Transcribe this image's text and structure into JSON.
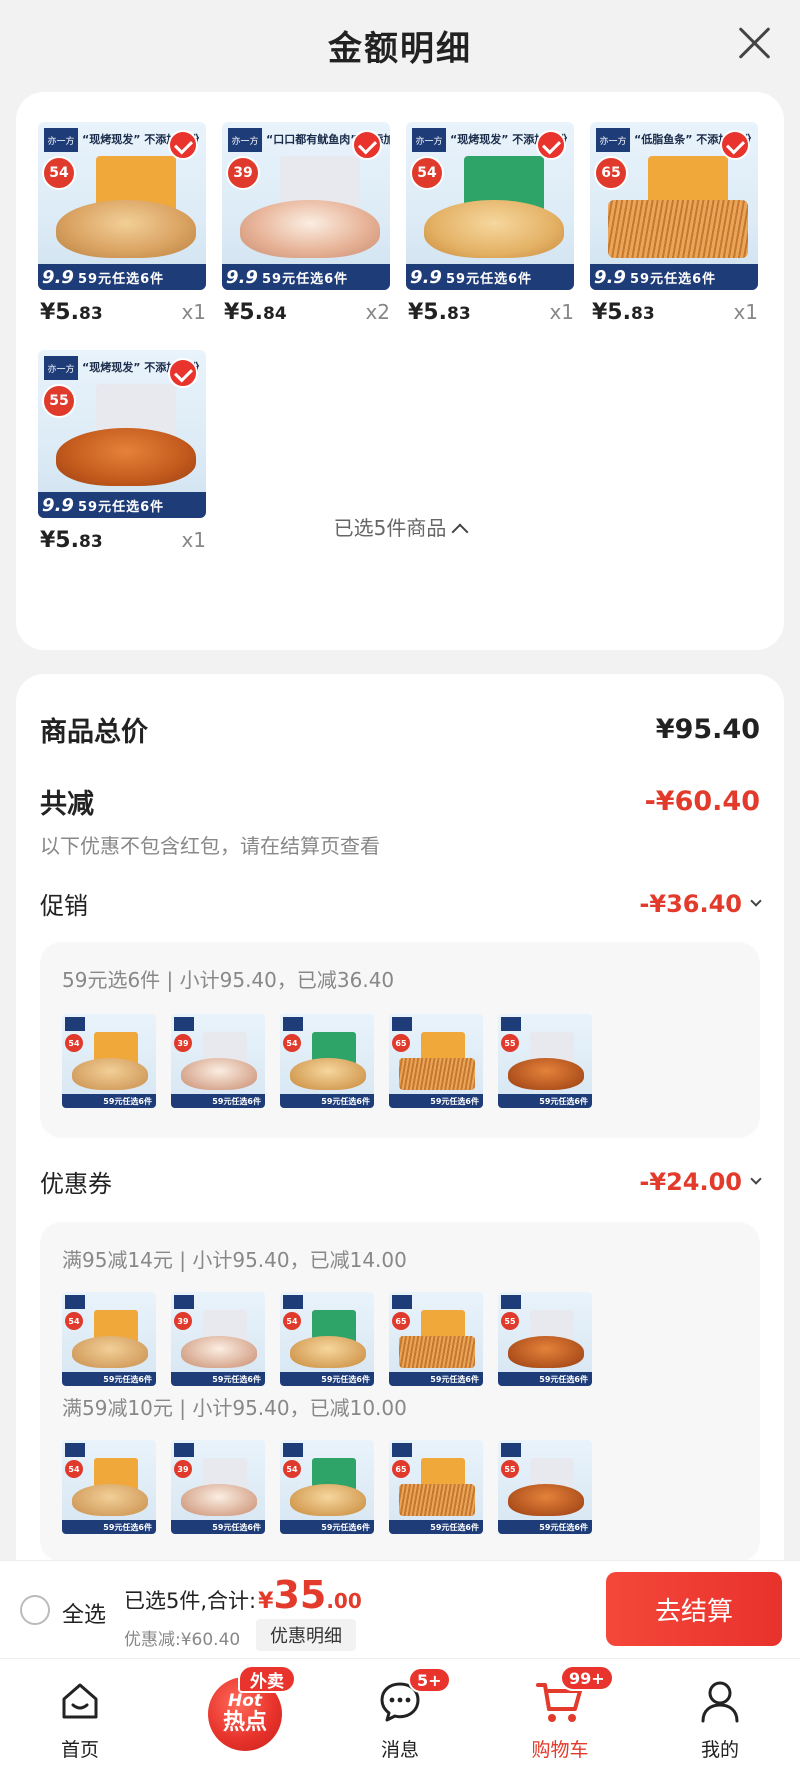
{
  "header": {
    "title": "金额明细"
  },
  "colors": {
    "accent": "#e23a2b",
    "navy": "#1e3c78",
    "button": "#e8322c"
  },
  "items": [
    {
      "slogan": "“现烤现发” 不添加淀粉",
      "nrv": "54",
      "pack": "orange",
      "food": "fish",
      "price_int": "¥5.",
      "price_dec": "83",
      "qty": "x1",
      "band": "59元任选6件",
      "nine": "9.9"
    },
    {
      "slogan": "“口口都有鱿鱼肉” 不添加淀粉",
      "nrv": "39",
      "pack": "gray",
      "food": "squid",
      "price_int": "¥5.",
      "price_dec": "84",
      "qty": "x2",
      "band": "59元任选6件",
      "nine": "9.9"
    },
    {
      "slogan": "“现烤现发” 不添加淀粉",
      "nrv": "54",
      "pack": "green",
      "food": "cake",
      "price_int": "¥5.",
      "price_dec": "83",
      "qty": "x1",
      "band": "59元任选6件",
      "nine": "9.9"
    },
    {
      "slogan": "“低脂鱼条” 不添加淀粉",
      "nrv": "65",
      "pack": "orange",
      "food": "stick",
      "price_int": "¥5.",
      "price_dec": "83",
      "qty": "x1",
      "band": "59元任选6件",
      "nine": "9.9"
    },
    {
      "slogan": "“现烤现发” 不添加淀粉",
      "nrv": "55",
      "pack": "gray",
      "food": "spicy",
      "price_int": "¥5.",
      "price_dec": "83",
      "qty": "x1",
      "band": "59元任选6件",
      "nine": "9.9"
    }
  ],
  "selected_toggle": "已选5件商品",
  "summary": {
    "total_label": "商品总价",
    "total_value": "¥95.40",
    "reduce_label": "共减",
    "reduce_value": "-¥60.40",
    "note": "以下优惠不包含红包，请在结算页查看",
    "promo_label": "促销",
    "promo_value": "-¥36.40",
    "promo_desc": "59元选6件 | 小计95.40，已减36.40",
    "coupon_label": "优惠券",
    "coupon_value": "-¥24.00",
    "coupon_desc_1": "满95减14元 | 小计95.40，已减14.00",
    "coupon_desc_2": "满59减10元 | 小计95.40，已减10.00"
  },
  "checkout": {
    "select_all": "全选",
    "sum_text": "已选5件,合计:",
    "currency": "¥",
    "amount_int": "35",
    "amount_dec": ".00",
    "discount": "优惠减:¥60.40",
    "detail_button": "优惠明细",
    "go_button": "去结算"
  },
  "nav": [
    {
      "label": "首页",
      "icon": "home-icon"
    },
    {
      "label": "热点",
      "icon": "hot-icon",
      "badge": "外卖",
      "hot_top": "Hot",
      "hot_main": "热点"
    },
    {
      "label": "消息",
      "icon": "message-icon",
      "badge": "5+"
    },
    {
      "label": "购物车",
      "icon": "cart-icon",
      "badge": "99+"
    },
    {
      "label": "我的",
      "icon": "profile-icon"
    }
  ]
}
